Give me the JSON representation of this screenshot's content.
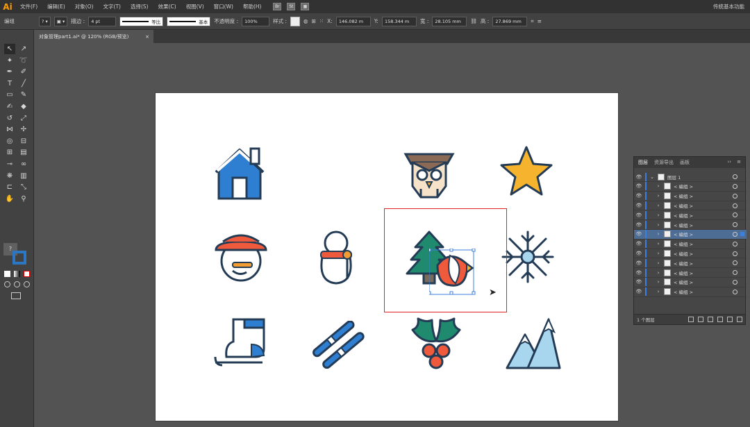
{
  "menubar": {
    "logo": "Ai",
    "items": [
      "文件(F)",
      "编辑(E)",
      "对象(O)",
      "文字(T)",
      "选择(S)",
      "效果(C)",
      "视图(V)",
      "窗口(W)",
      "帮助(H)"
    ],
    "workspace": "传统基本功能"
  },
  "controlbar": {
    "group_label": "编组",
    "stroke_label": "描边 :",
    "stroke_value": "4 pt",
    "stroke_style": "等比",
    "brush_label": "基本",
    "opacity_label": "不透明度 :",
    "opacity_value": "100%",
    "style_label": "样式 :",
    "x_label": "X:",
    "x_value": "146.082 m",
    "y_label": "Y:",
    "y_value": "158.344 m",
    "w_label": "宽 :",
    "w_value": "28.105 mm",
    "h_label": "高 :",
    "h_value": "27.869 mm"
  },
  "document": {
    "tab_title": "对象管理part1.ai* @ 120% (RGB/预览)",
    "close": "×"
  },
  "toolbar": {
    "tooltip": "?"
  },
  "layers_panel": {
    "tabs": [
      "图层",
      "资源导出",
      "画板"
    ],
    "menu": "≡",
    "collapse": "››",
    "layer_name": "图层 1",
    "rows": [
      {
        "label": "< 编组 >",
        "selected": false
      },
      {
        "label": "< 编组 >",
        "selected": false
      },
      {
        "label": "< 编组 >",
        "selected": false
      },
      {
        "label": "< 编组 >",
        "selected": false
      },
      {
        "label": "< 编组 >",
        "selected": false
      },
      {
        "label": "< 编组 >",
        "selected": true
      },
      {
        "label": "< 编组 >",
        "selected": false
      },
      {
        "label": "< 编组 >",
        "selected": false
      },
      {
        "label": "< 编组 >",
        "selected": false
      },
      {
        "label": "< 编组 >",
        "selected": false
      },
      {
        "label": "< 编组 >",
        "selected": false
      },
      {
        "label": "< 编组 >",
        "selected": false
      }
    ],
    "footer": "1 个图层"
  },
  "colors": {
    "selection_red": "#e02020",
    "selection_blue": "#3b7fe0",
    "artboard": "#ffffff",
    "canvas": "#535353"
  }
}
